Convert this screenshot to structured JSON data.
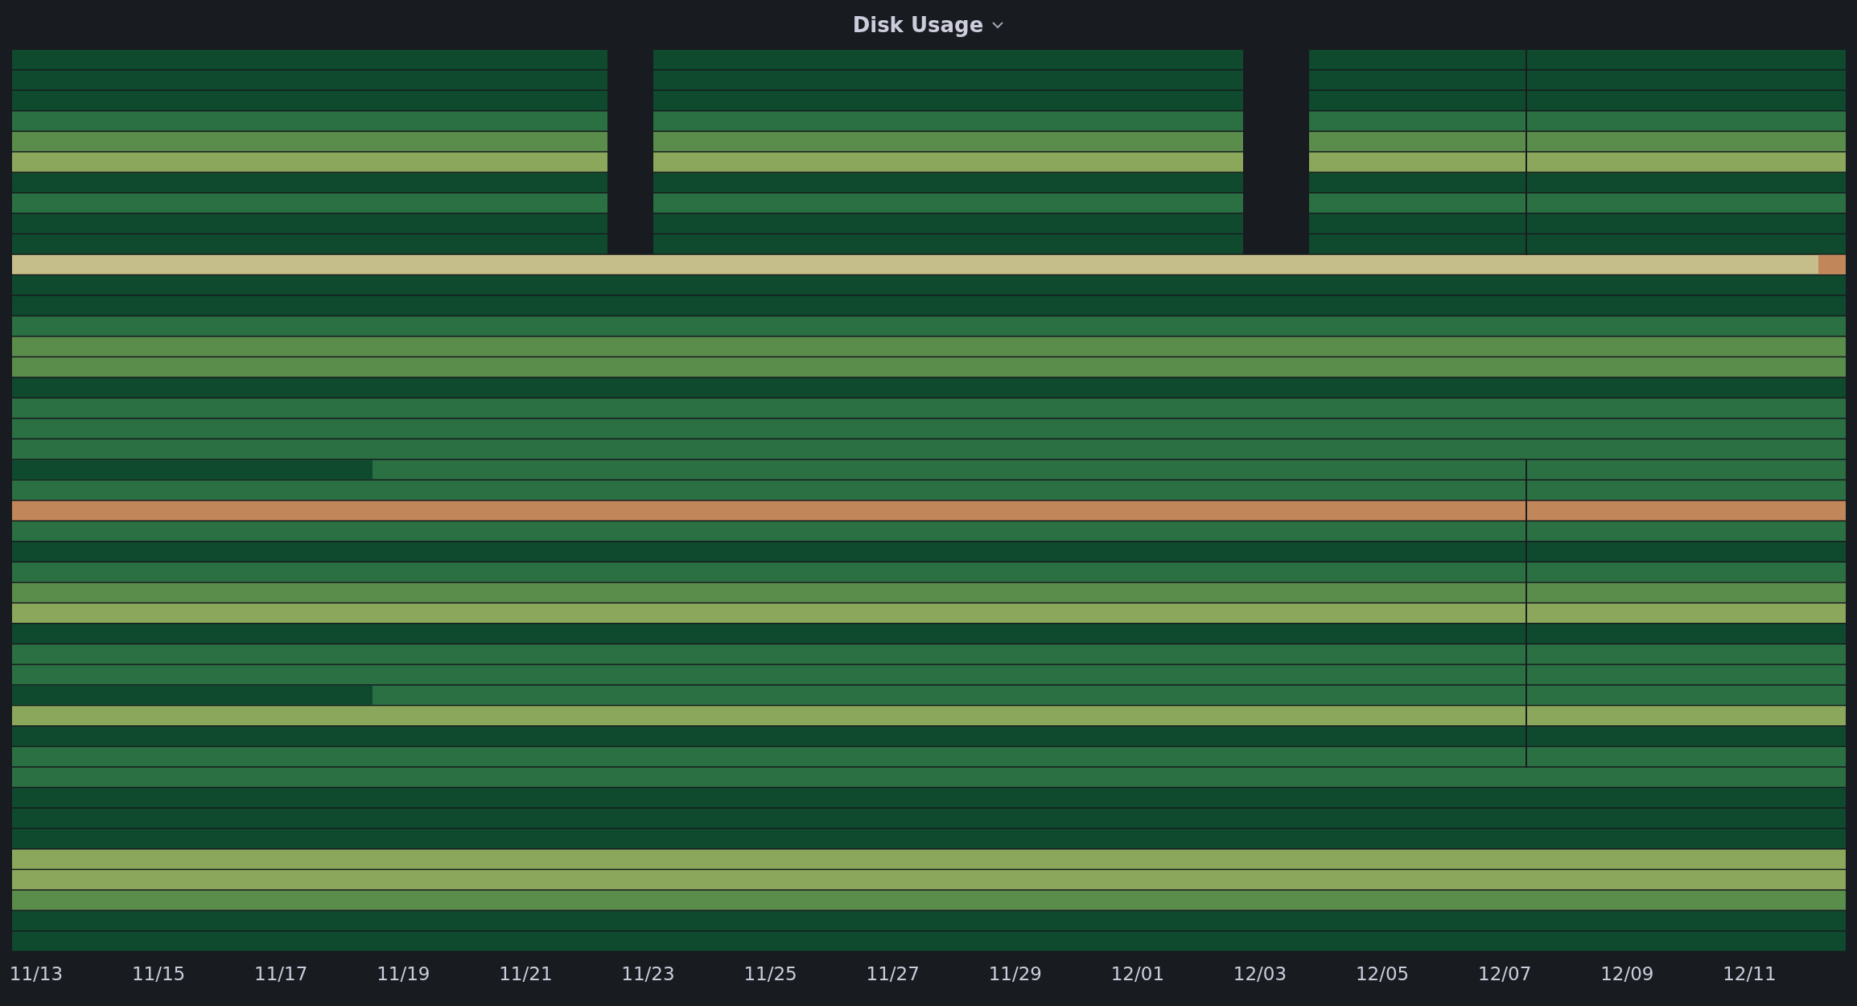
{
  "panel": {
    "title": "Disk Usage",
    "x_ticks": [
      "11/13",
      "11/15",
      "11/17",
      "11/19",
      "11/21",
      "11/23",
      "11/25",
      "11/27",
      "11/29",
      "12/01",
      "12/03",
      "12/05",
      "12/07",
      "12/09",
      "12/11"
    ]
  }
}
